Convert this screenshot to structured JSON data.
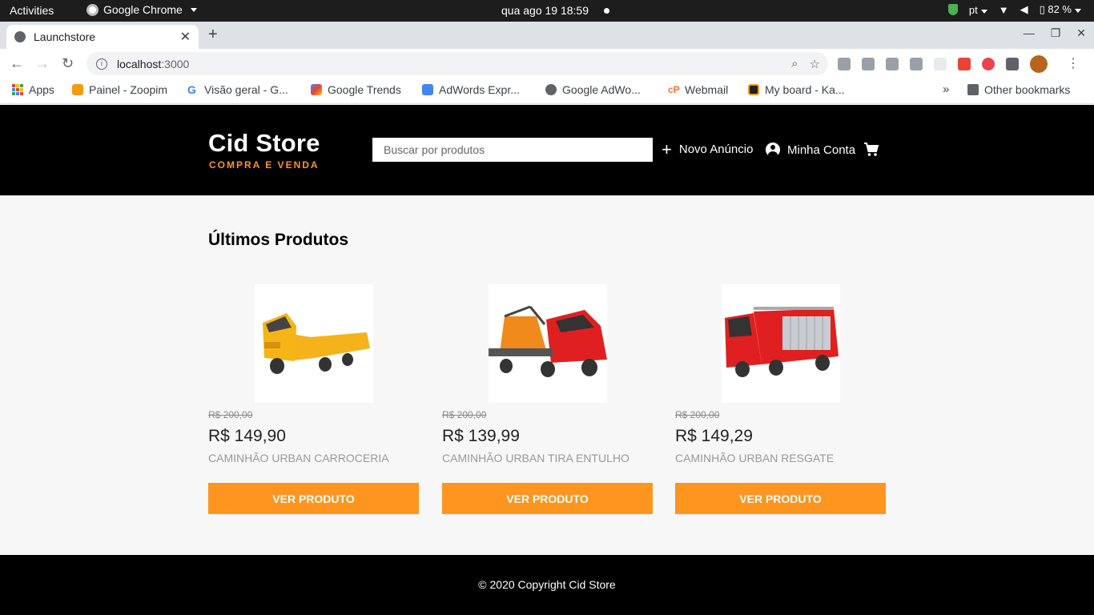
{
  "os_bar": {
    "activities": "Activities",
    "app_name": "Google Chrome",
    "clock": "qua ago 19  18:59",
    "language": "pt",
    "battery": "82 %"
  },
  "browser": {
    "tab_title": "Launchstore",
    "url_host": "localhost",
    "url_port": ":3000",
    "bookmarks": [
      {
        "label": "Apps"
      },
      {
        "label": "Painel - Zoopim"
      },
      {
        "label": "Visão geral - G..."
      },
      {
        "label": "Google Trends"
      },
      {
        "label": "AdWords Expr..."
      },
      {
        "label": "Google AdWo..."
      },
      {
        "label": "Webmail"
      },
      {
        "label": "My board - Ka..."
      }
    ],
    "other_bookmarks": "Other bookmarks"
  },
  "header": {
    "logo_title": "Cid Store",
    "logo_subtitle": "COMPRA E VENDA",
    "search_placeholder": "Buscar por produtos",
    "new_ad": "Novo Anúncio",
    "account": "Minha Conta"
  },
  "main": {
    "section_title": "Últimos Produtos",
    "products": [
      {
        "old_price": "R$ 200,00",
        "price": "R$ 149,90",
        "name": "CAMINHÃO URBAN CARROCERIA",
        "button": "VER PRODUTO",
        "truck_color": "#f6b21a"
      },
      {
        "old_price": "R$ 200,00",
        "price": "R$ 139,99",
        "name": "CAMINHÃO URBAN TIRA ENTULHO",
        "button": "VER PRODUTO",
        "truck_color": "#e02020"
      },
      {
        "old_price": "R$ 200,00",
        "price": "R$ 149,29",
        "name": "CAMINHÃO URBAN RESGATE",
        "button": "VER PRODUTO",
        "truck_color": "#e02020"
      }
    ]
  },
  "footer": {
    "copyright": "© 2020 Copyright Cid Store"
  },
  "colors": {
    "accent": "#fd951f",
    "header_bg": "#000000",
    "page_bg": "#f7f7f7"
  }
}
